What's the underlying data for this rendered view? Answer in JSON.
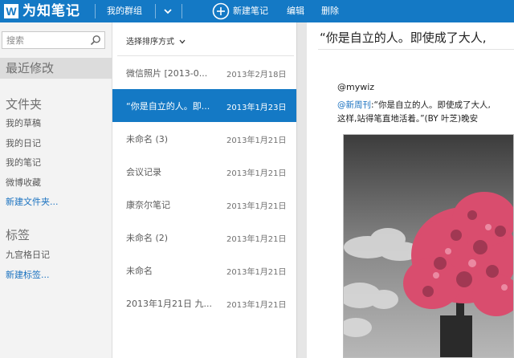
{
  "topbar": {
    "logo_letter": "W",
    "app_name": "为知笔记",
    "group_label": "我的群组",
    "new_note_label": "新建笔记",
    "edit_label": "编辑",
    "delete_label": "删除",
    "bg_color": "#1479c5"
  },
  "sidebar": {
    "search_placeholder": "搜索",
    "recent_label": "最近修改",
    "folders_heading": "文件夹",
    "folders": [
      "我的草稿",
      "我的日记",
      "我的笔记",
      "微博收藏"
    ],
    "new_folder_label": "新建文件夹...",
    "tags_heading": "标签",
    "tags": [
      "九宫格日记"
    ],
    "new_tag_label": "新建标签..."
  },
  "note_list": {
    "sort_label": "选择排序方式",
    "selected_index": 1,
    "notes": [
      {
        "title": "微信照片 [2013-0...",
        "date": "2013年2月18日"
      },
      {
        "title": "“你是自立的人。即...",
        "date": "2013年1月23日"
      },
      {
        "title": "未命名 (3)",
        "date": "2013年1月21日"
      },
      {
        "title": "会议记录",
        "date": "2013年1月21日"
      },
      {
        "title": "康奈尔笔记",
        "date": "2013年1月21日"
      },
      {
        "title": "未命名 (2)",
        "date": "2013年1月21日"
      },
      {
        "title": "未命名",
        "date": "2013年1月21日"
      },
      {
        "title": "2013年1月21日 九...",
        "date": "2013年1月21日"
      }
    ]
  },
  "reader": {
    "heading": "“你是自立的人。即使成了大人,",
    "author": "@mywiz",
    "mention": "@新周刊",
    "line1_rest": ":“你是自立的人。即使成了大人,",
    "line2": "这样,站得笔直地活着。”(BY 叶芝)晚安",
    "accent_color": "#1a72c0"
  }
}
